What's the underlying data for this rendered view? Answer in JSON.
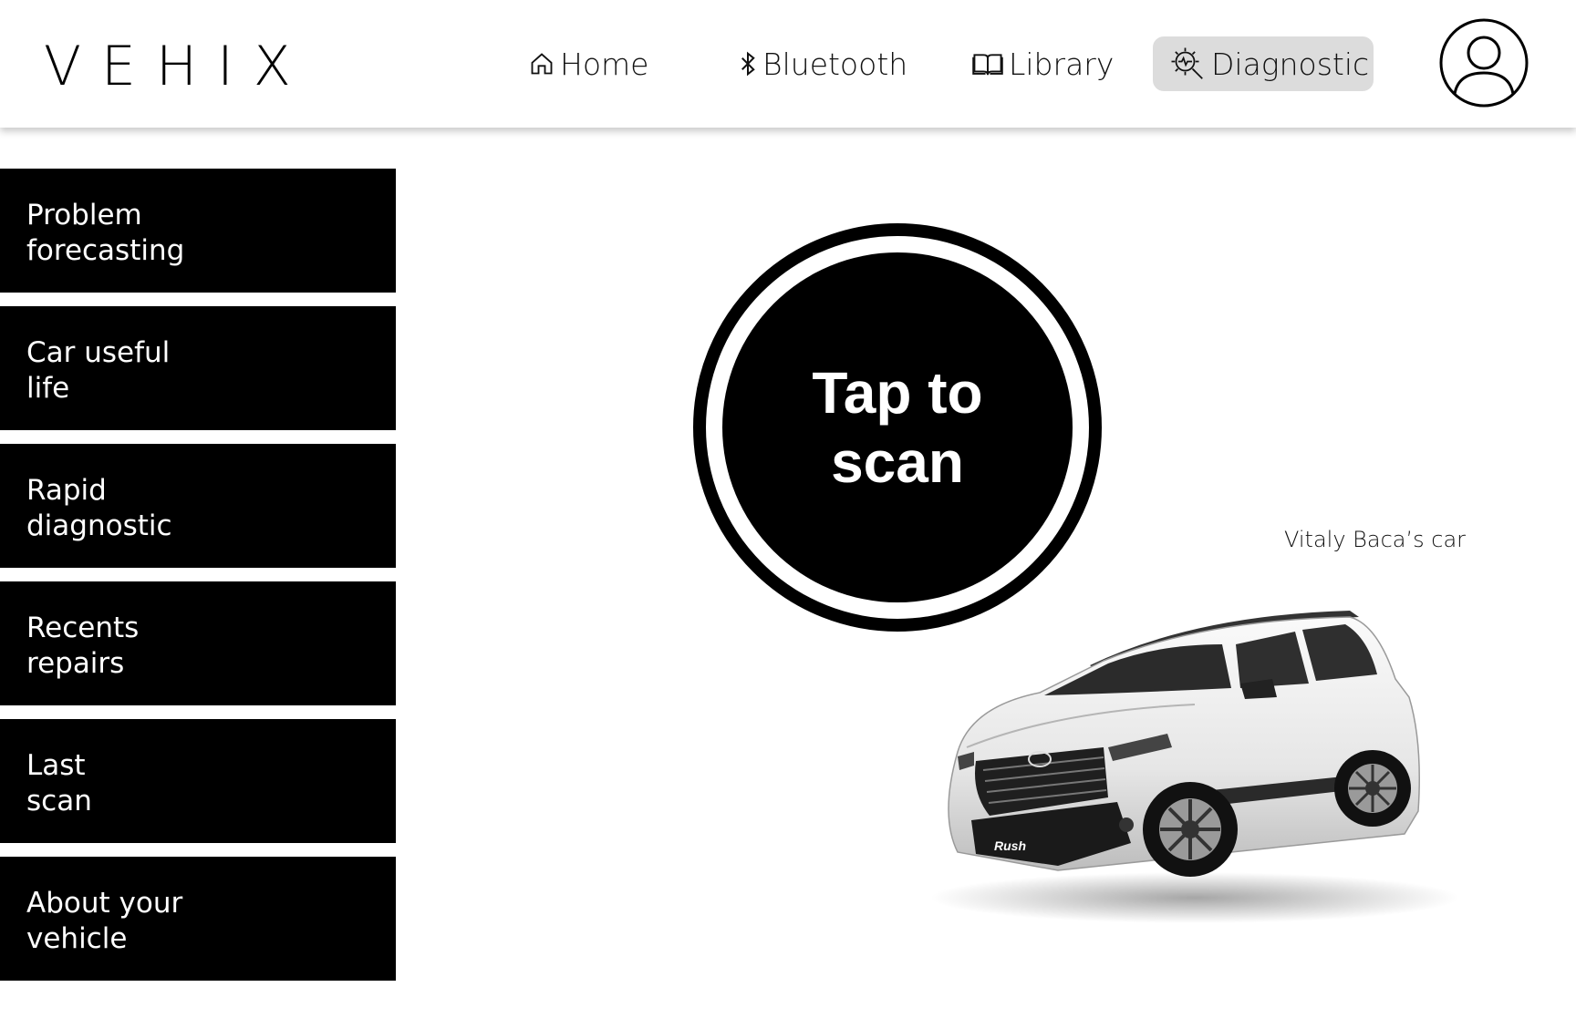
{
  "app": {
    "logo": "VEHIX"
  },
  "nav": {
    "items": [
      {
        "label": "Home",
        "icon": "home-icon"
      },
      {
        "label": "Bluetooth",
        "icon": "bluetooth-icon"
      },
      {
        "label": "Library",
        "icon": "book-icon"
      },
      {
        "label": "Diagnostic",
        "icon": "diagnostic-gear-icon",
        "active": true
      }
    ],
    "profile_icon": "user-profile-icon"
  },
  "sidebar": {
    "items": [
      {
        "label": "Problem\nforecasting"
      },
      {
        "label": "Car useful\nlife"
      },
      {
        "label": "Rapid\ndiagnostic"
      },
      {
        "label": "Recents\nrepairs"
      },
      {
        "label": "Last\nscan"
      },
      {
        "label": "About your\nvehicle"
      }
    ]
  },
  "scan": {
    "label": "Tap to\nscan"
  },
  "vehicle": {
    "caption": "Vitaly Baca’s car",
    "badge": "Rush",
    "image": "white-suv-image"
  },
  "colors": {
    "primary": "#000000",
    "background": "#ffffff",
    "active_tab": "#dcdcdc"
  }
}
